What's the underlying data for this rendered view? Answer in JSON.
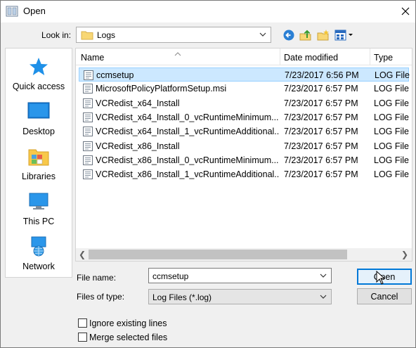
{
  "window": {
    "title": "Open",
    "close_icon": "close-icon"
  },
  "lookin": {
    "label": "Look in:",
    "value": "Logs"
  },
  "toolbar": [
    "back-icon",
    "up-folder-icon",
    "new-folder-icon",
    "view-menu-icon"
  ],
  "places": [
    {
      "label": "Quick access",
      "icon": "star-icon"
    },
    {
      "label": "Desktop",
      "icon": "desktop-icon"
    },
    {
      "label": "Libraries",
      "icon": "libraries-icon"
    },
    {
      "label": "This PC",
      "icon": "computer-icon"
    },
    {
      "label": "Network",
      "icon": "network-icon"
    }
  ],
  "columns": {
    "name": "Name",
    "date": "Date modified",
    "type": "Type"
  },
  "files": [
    {
      "name": "ccmsetup",
      "date": "7/23/2017 6:56 PM",
      "type": "LOG File",
      "selected": true
    },
    {
      "name": "MicrosoftPolicyPlatformSetup.msi",
      "date": "7/23/2017 6:57 PM",
      "type": "LOG File"
    },
    {
      "name": "VCRedist_x64_Install",
      "date": "7/23/2017 6:57 PM",
      "type": "LOG File"
    },
    {
      "name": "VCRedist_x64_Install_0_vcRuntimeMinimum...",
      "date": "7/23/2017 6:57 PM",
      "type": "LOG File"
    },
    {
      "name": "VCRedist_x64_Install_1_vcRuntimeAdditional...",
      "date": "7/23/2017 6:57 PM",
      "type": "LOG File"
    },
    {
      "name": "VCRedist_x86_Install",
      "date": "7/23/2017 6:57 PM",
      "type": "LOG File"
    },
    {
      "name": "VCRedist_x86_Install_0_vcRuntimeMinimum...",
      "date": "7/23/2017 6:57 PM",
      "type": "LOG File"
    },
    {
      "name": "VCRedist_x86_Install_1_vcRuntimeAdditional...",
      "date": "7/23/2017 6:57 PM",
      "type": "LOG File"
    }
  ],
  "filename": {
    "label": "File name:",
    "value": "ccmsetup"
  },
  "filetype": {
    "label": "Files of type:",
    "value": "Log Files (*.log)"
  },
  "buttons": {
    "open": "Open",
    "cancel": "Cancel"
  },
  "options": [
    {
      "label": "Ignore existing lines",
      "checked": false
    },
    {
      "label": "Merge selected files",
      "checked": false
    }
  ],
  "colors": {
    "selection": "#cce8ff",
    "accent": "#0078d7",
    "folder": "#f8d775"
  }
}
